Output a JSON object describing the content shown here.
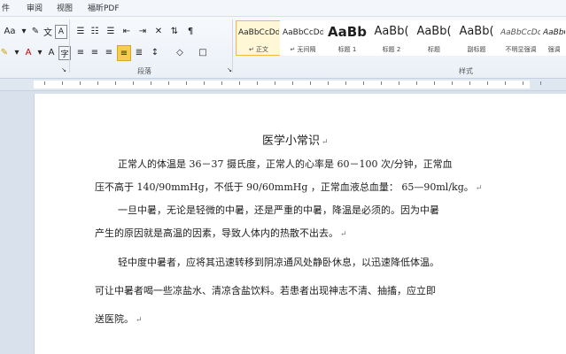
{
  "tabs": [
    "件",
    "审阅",
    "视图",
    "福昕PDF"
  ],
  "groups": {
    "paragraph_label": "段落",
    "styles_label": "样式"
  },
  "styles": [
    {
      "sample": "AaBbCcDd",
      "name": "↵ 正文"
    },
    {
      "sample": "AaBbCcDd",
      "name": "↵ 无间隔"
    },
    {
      "sample": "AaBb",
      "name": "标题 1"
    },
    {
      "sample": "AaBb(",
      "name": "标题 2"
    },
    {
      "sample": "AaBb(",
      "name": "标题"
    },
    {
      "sample": "AaBb(",
      "name": "副标题"
    },
    {
      "sample": "AaBbCcDd",
      "name": "不明显强调"
    },
    {
      "sample": "AaBbCcD",
      "name": "强调"
    }
  ],
  "doc": {
    "title": "医学小常识",
    "lines": [
      "正常人的体温是 36－37 摄氏度，正常人的心率是 60－100 次/分钟，正常血",
      "压不高于 140/90mmHg，不低于 90/60mmHg ，正常血液总血量： 65—90ml/kg。",
      "一旦中暑，无论是轻微的中暑，还是严重的中暑，降温是必须的。因为中暑",
      "产生的原因就是高温的因素，导致人体内的热散不出去。",
      "轻中度中暑者，应将其迅速转移到阴凉通风处静卧休息，以迅速降低体温。",
      "可让中暑者喝一些凉盐水、清凉含盐饮料。若患者出现神志不清、抽搐，应立即",
      "送医院。"
    ]
  },
  "paragraph_mark": "↵"
}
